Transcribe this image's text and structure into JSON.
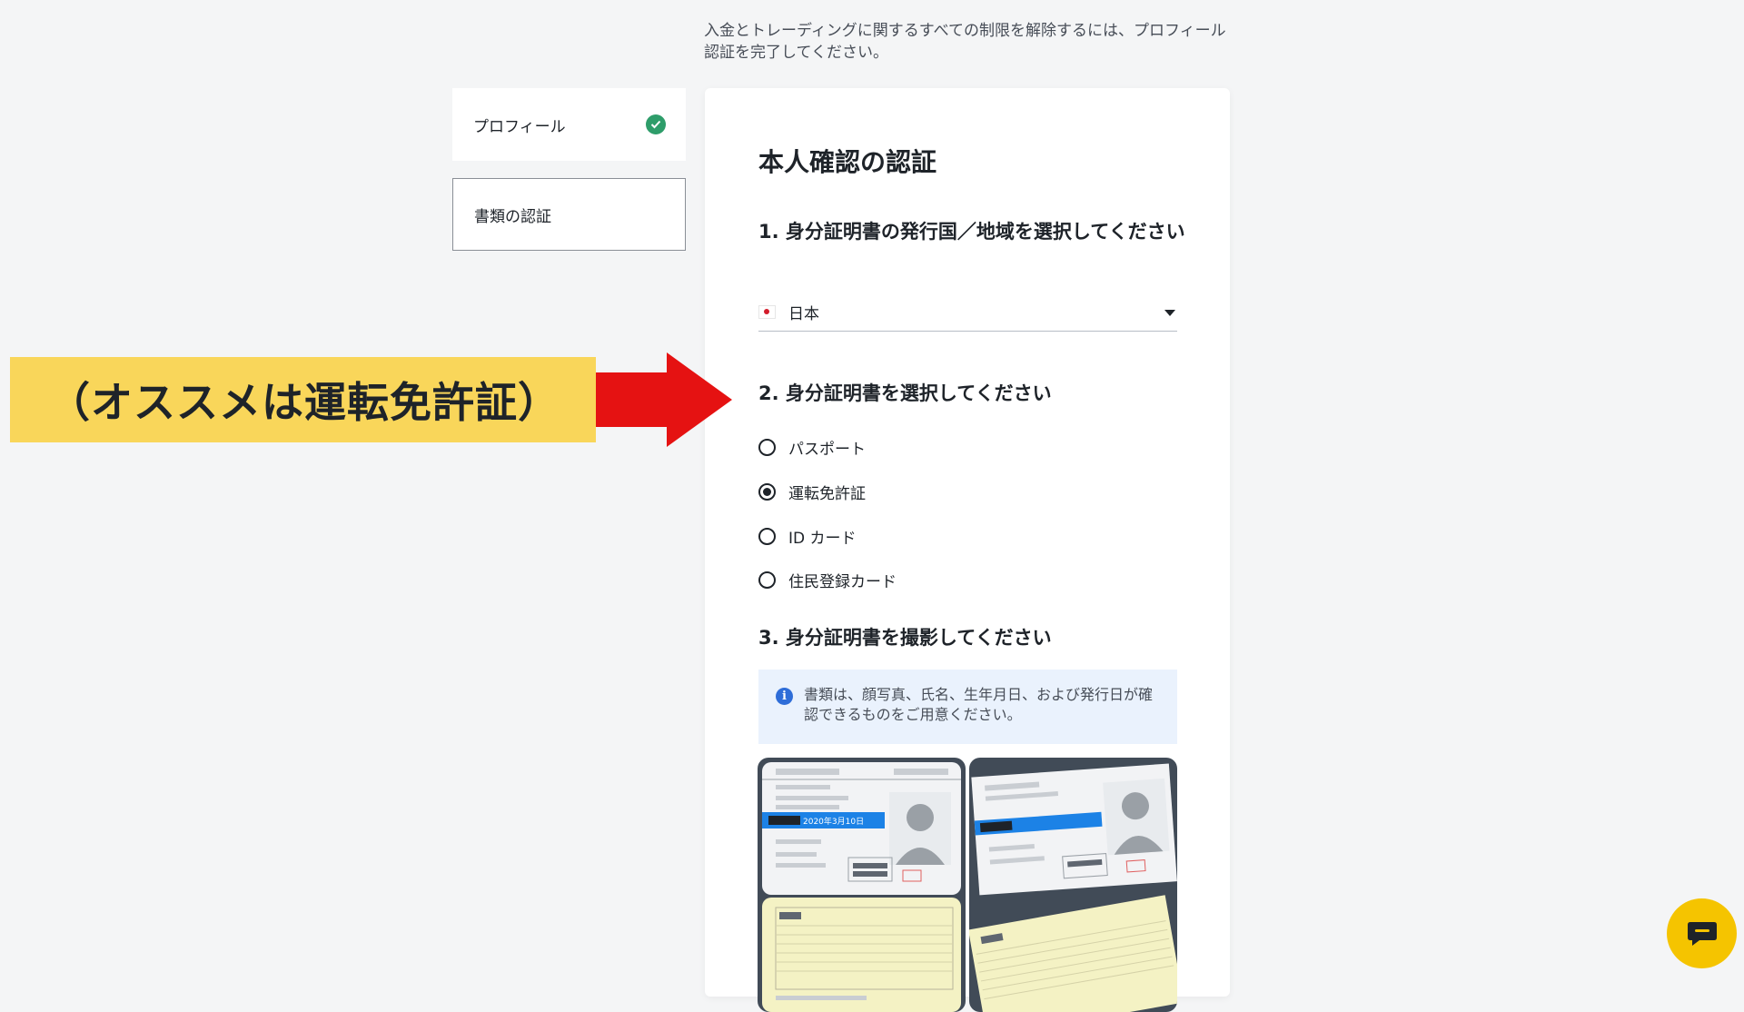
{
  "intro_text": "入金とトレーディングに関するすべての制限を解除するには、プロフィール認証を完了してください。",
  "sidebar": {
    "profile_label": "プロフィール",
    "docs_label": "書類の認証"
  },
  "card": {
    "title": "本人確認の認証",
    "step1_title": "1. 身分証明書の発行国／地域を選択してください",
    "country_value": "日本",
    "step2_title": "2. 身分証明書を選択してください",
    "id_options": [
      {
        "label": "パスポート",
        "selected": false
      },
      {
        "label": "運転免許証",
        "selected": true
      },
      {
        "label": "ID カード",
        "selected": false
      },
      {
        "label": "住民登録カード",
        "selected": false
      }
    ],
    "step3_title": "3. 身分証明書を撮影してください",
    "notice_text": "書類は、顔写真、氏名、生年月日、および発行日が確認できるものをご用意ください。",
    "card_sample_text": "2020年3月10日"
  },
  "annotation": {
    "banner_text": "（オススメは運転免許証）",
    "arrow_color": "#e51212",
    "banner_color": "#f9d65a"
  },
  "colors": {
    "check_green": "#2e9d6a",
    "chat_yellow": "#f5c400",
    "info_blue": "#2e6dd8"
  }
}
